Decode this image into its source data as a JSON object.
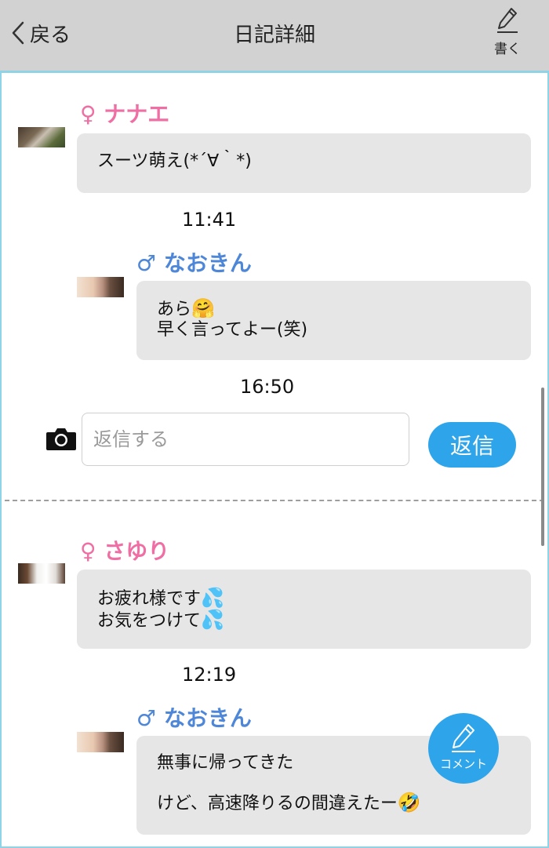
{
  "header": {
    "back_label": "戻る",
    "title": "日記詳細",
    "write_label": "書く"
  },
  "thread1": {
    "comment": {
      "gender_symbol": "♀",
      "name": "ナナエ",
      "text": "スーツ萌え(*´∀｀*)",
      "time": "11:41"
    },
    "reply": {
      "gender_symbol": "♂",
      "name": "なおきん",
      "line1": "あら",
      "line1_emoji": "🤗",
      "line2": "早く言ってよー(笑)",
      "time": "16:50"
    },
    "reply_box": {
      "placeholder": "返信する",
      "button_label": "返信"
    }
  },
  "thread2": {
    "comment": {
      "gender_symbol": "♀",
      "name": "さゆり",
      "line1": "お疲れ様です",
      "line1_emoji": "💦",
      "line2": "お気をつけて",
      "line2_emoji": "💦",
      "time": "12:19"
    },
    "reply": {
      "gender_symbol": "♂",
      "name": "なおきん",
      "line1": "無事に帰ってきた",
      "line2": "けど、高速降りるの間違えたー",
      "line2_emoji": "🤣"
    }
  },
  "fab": {
    "label": "コメント"
  },
  "colors": {
    "header_bg": "#d2d2d2",
    "frame_border": "#8fd3e6",
    "female": "#ef6fa4",
    "male": "#4e86d8",
    "bubble_bg": "#e6e6e6",
    "accent": "#2ea4ea"
  },
  "icons": {
    "back": "chevron-left-icon",
    "write": "pencil-icon",
    "camera": "camera-icon",
    "fab": "pencil-icon"
  }
}
